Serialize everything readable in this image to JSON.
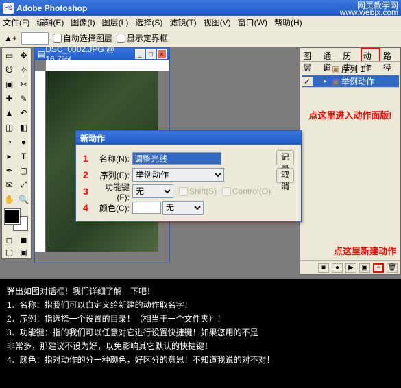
{
  "titlebar": {
    "app": "Adobe Photoshop"
  },
  "watermark": {
    "line1": "网页教学网",
    "line2": "www.webjx.com"
  },
  "menu": {
    "file": "文件(F)",
    "edit": "编辑(E)",
    "image": "图像(I)",
    "layer": "图层(L)",
    "select": "选择(S)",
    "filter": "滤镜(T)",
    "view": "视图(V)",
    "window": "窗口(W)",
    "help": "帮助(H)"
  },
  "optbar": {
    "auto_select_layer": "自动选择图层",
    "show_bbox": "显示定界框"
  },
  "docwin": {
    "title": "DSC_0002.JPG @ 16.7%(..."
  },
  "panel": {
    "tabs": {
      "layers": "图层",
      "channels": "通道",
      "history": "历史",
      "actions": "动作",
      "paths": "路径"
    },
    "rows": [
      {
        "check": "✓",
        "folder": "▸",
        "name": "序列 1"
      },
      {
        "check": "✓",
        "folder": "▸",
        "name": "举例动作"
      }
    ],
    "hint1": "点这里进入动作面版!",
    "hint2": "点这里新建动作"
  },
  "dialog": {
    "title": "新动作",
    "name_label": "名称(N):",
    "name_value": "调整光线",
    "series_label": "序列(E):",
    "series_value": "举例动作",
    "func_label": "功能键(F):",
    "func_value": "无",
    "shift": "Shift(S)",
    "ctrl": "Control(O)",
    "color_label": "颜色(C):",
    "color_value": "无",
    "record": "记录",
    "cancel": "取消",
    "nums": {
      "n1": "1",
      "n2": "2",
      "n3": "3",
      "n4": "4"
    }
  },
  "caption": {
    "l1": "弹出如图对话框！我们详细了解一下吧！",
    "l2": "1．名称：指我们可以自定义给新建的动作取名字！",
    "l3": "2．序例：指选择一个设置的目录！（相当于一个文件夹）！",
    "l4": "3．功能键：指的我们可以任意对它进行设置快捷键！如果您用的不是",
    "l5": "非常多，那建议不设为好，以免影响其它默认的快捷键！",
    "l6": "4．颜色：指对动作的分一种颜色，好区分的意思！不知道我说的对不对！"
  }
}
